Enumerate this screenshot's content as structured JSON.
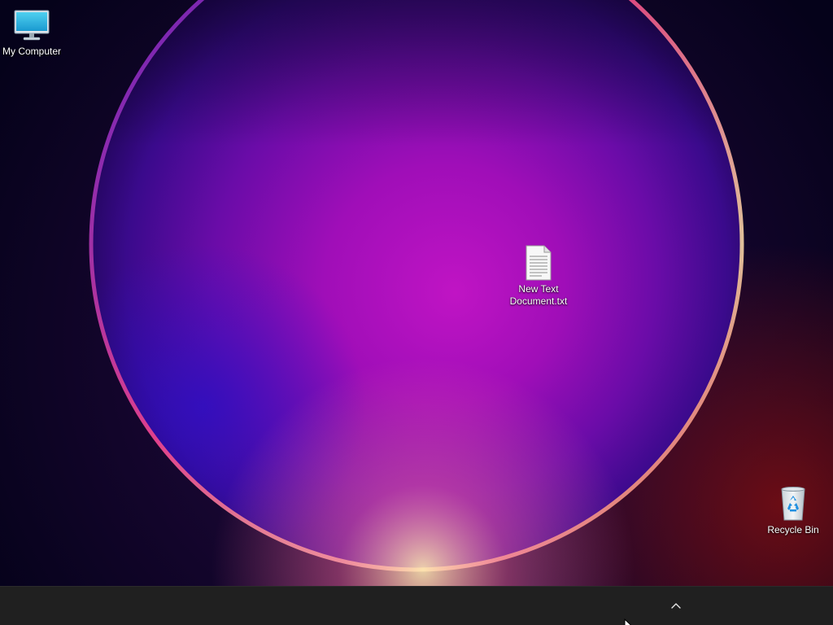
{
  "desktop": {
    "icons": [
      {
        "label": "My Computer",
        "icon": "monitor-icon"
      },
      {
        "label": "New Text Document.txt",
        "icon": "text-document-icon"
      },
      {
        "label": "Recycle Bin",
        "icon": "recycle-bin-icon"
      }
    ]
  },
  "taskbar": {
    "tray_overflow_icon": "chevron-up-icon"
  },
  "colors": {
    "taskbar_bg": "#202020",
    "wallpaper_base": "#07031a",
    "wallpaper_glow": "#a012c0",
    "wallpaper_rim": "#ff3a6a"
  }
}
